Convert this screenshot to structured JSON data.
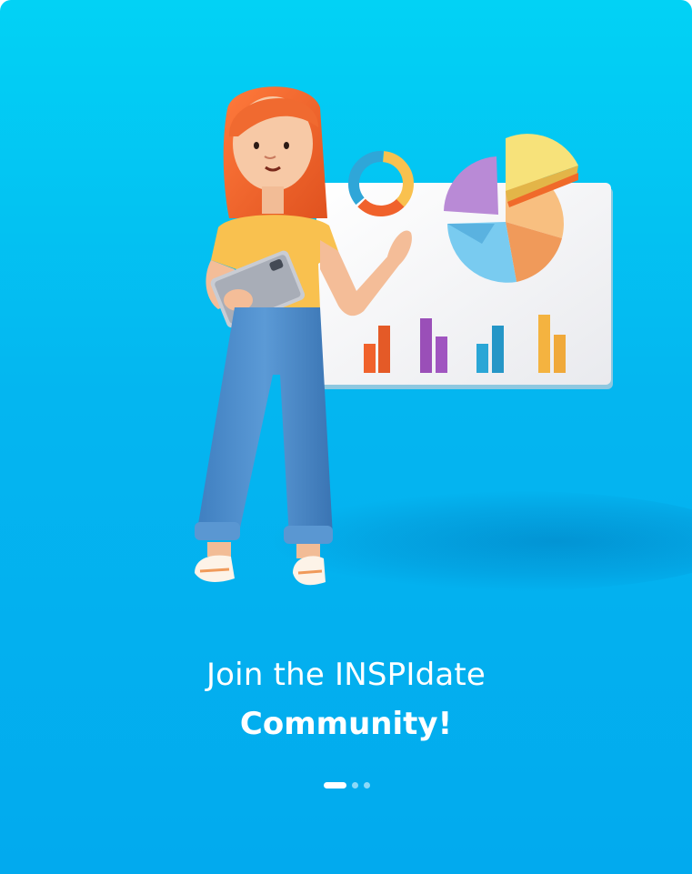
{
  "onboarding": {
    "title_line1": "Join the INSPIdate",
    "title_line2": "Community!",
    "pagination": {
      "current": 1,
      "total": 3
    }
  },
  "illustration": {
    "subject": "woman presenting charts on a board",
    "icons": [
      "donut-chart-icon",
      "pie-chart-icon",
      "bar-chart-icon"
    ],
    "colors": {
      "background_top": "#02d2f5",
      "background_bottom": "#02aaee",
      "hair": "#f0622c",
      "shirt": "#f9c14f",
      "pants": "#4f8fcf",
      "board": "#f3f3f5"
    }
  }
}
